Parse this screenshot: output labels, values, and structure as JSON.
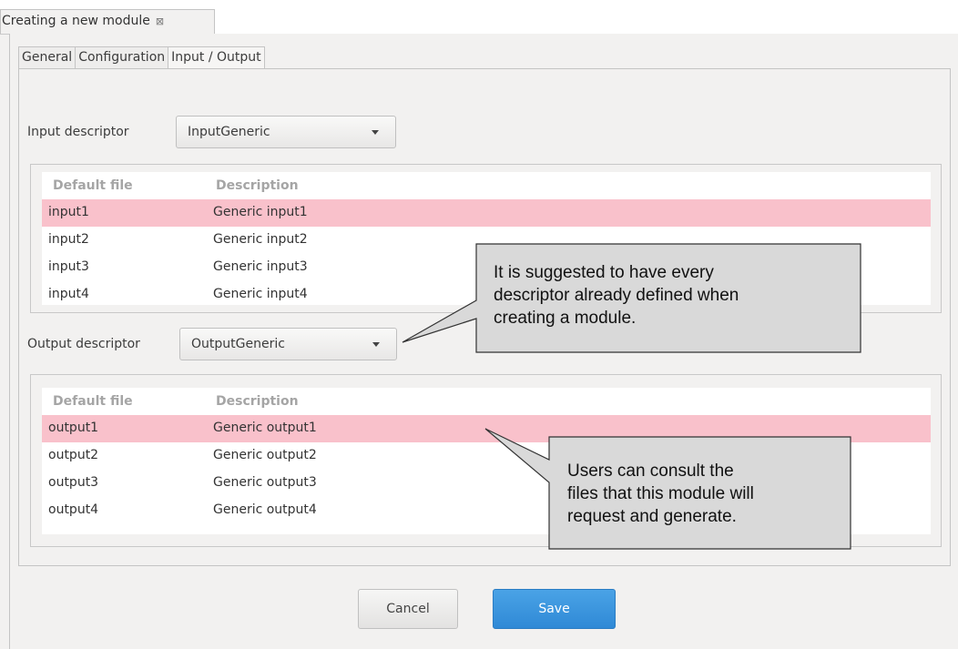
{
  "editor_tab": {
    "title": "Creating a new module",
    "close_glyph": "⊠"
  },
  "tabs": [
    {
      "label": "General"
    },
    {
      "label": "Configuration"
    },
    {
      "label": "Input / Output"
    }
  ],
  "input": {
    "label": "Input descriptor",
    "selected": "InputGeneric",
    "columns": [
      "Default file",
      "Description"
    ],
    "rows": [
      {
        "file": "input1",
        "description": "Generic input1",
        "selected": true
      },
      {
        "file": "input2",
        "description": "Generic input2"
      },
      {
        "file": "input3",
        "description": "Generic input3"
      },
      {
        "file": "input4",
        "description": "Generic input4"
      }
    ]
  },
  "output": {
    "label": "Output descriptor",
    "selected": "OutputGeneric",
    "columns": [
      "Default file",
      "Description"
    ],
    "rows": [
      {
        "file": "output1",
        "description": "Generic output1",
        "selected": true
      },
      {
        "file": "output2",
        "description": "Generic output2"
      },
      {
        "file": "output3",
        "description": "Generic output3"
      },
      {
        "file": "output4",
        "description": "Generic output4"
      }
    ]
  },
  "callouts": {
    "descriptor": [
      "It is suggested to have every",
      "descriptor already defined when",
      "creating a module."
    ],
    "files": [
      "Users can consult the",
      "files that this module will",
      "request and generate."
    ]
  },
  "buttons": {
    "cancel": "Cancel",
    "save": "Save"
  },
  "colors": {
    "selected_row": "#f9c1cb",
    "save_button": "#3a93dc",
    "callout_fill": "#d9d9d9"
  }
}
